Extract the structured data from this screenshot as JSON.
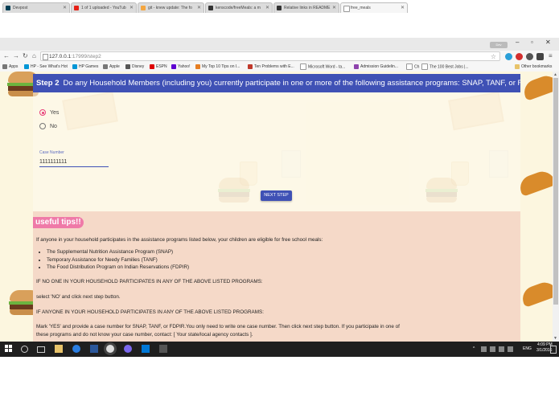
{
  "browser": {
    "tabs": [
      {
        "title": "Devpost",
        "color": "#003e54"
      },
      {
        "title": "1 of 1 uploaded - YouTub",
        "color": "#e62117"
      },
      {
        "title": "git - knew update: The fo",
        "color": "#f4a640"
      },
      {
        "title": "kenscode/freeMeals: a m",
        "color": "#333333"
      },
      {
        "title": "Relative links in README",
        "color": "#333333"
      },
      {
        "title": "free_meals",
        "color": "#ffffff"
      }
    ],
    "user_label": "Dev",
    "url_host": "127.0.0.1",
    "url_path": ":17999/step2",
    "bookmarks": [
      "Apps",
      "HP - See What's Hot",
      "HP Games",
      "Apple",
      "Disney",
      "ESPN",
      "Yahoo!",
      "My Top 10 Tips on I...",
      "Ten Problems with E...",
      "Microsoft Word - ta...",
      "Admission Guidelin...",
      "Ch",
      "The 100 Best Jobs |..."
    ],
    "other_bookmarks": "Other bookmarks"
  },
  "step": {
    "number": "Step 2",
    "question": "Do any Household Members (including you) currently participate in one or more of the following assistance programs: SNAP, TANF, or FDPIR?"
  },
  "form": {
    "options": [
      {
        "label": "Yes",
        "checked": true
      },
      {
        "label": "No",
        "checked": false
      }
    ],
    "case_number_label": "Case Number",
    "case_number_value": "1111111111",
    "next_label": "NEXT STEP"
  },
  "tips": {
    "badge": "useful tips!!",
    "intro": "If anyone in your household participates in the assistance programs listed below, your children are eligible for free school meals:",
    "programs": [
      "The Supplemental Nutrition Assistance Program (SNAP)",
      "Temporary Assistance for Needy Families (TANF)",
      "The Food Distribution Program on Indian Reservations (FDPIR)"
    ],
    "no_heading": "IF NO ONE IN YOUR HOUSEHOLD PARTICIPATES IN ANY OF THE ABOVE LISTED PROGRAMS:",
    "no_text": "select 'NO' and click next step button.",
    "yes_heading": "IF ANYONE IN YOUR HOUSEHOLD PARTICIPATES IN ANY OF THE ABOVE LISTED PROGRAMS:",
    "yes_text": "Mark 'YES' and provide a case number for SNAP, TANF, or FDPIR.You only need to write one case number. Then click next step button. If you participate in one of these programs and do not know your case number, contact: [ Your state/local agency contacts ]."
  },
  "taskbar": {
    "language": "ENG",
    "time": "4:09 PM",
    "date": "3/1/2016"
  }
}
